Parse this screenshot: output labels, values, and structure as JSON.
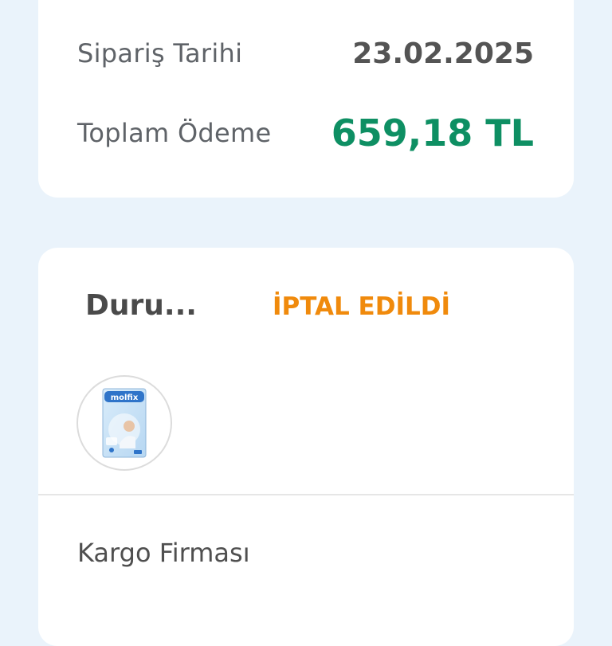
{
  "order": {
    "date_label": "Sipariş Tarihi",
    "date_value": "23.02.2025",
    "total_label": "Toplam Ödeme",
    "total_value": "659,18 TL"
  },
  "status": {
    "label": "Duru...",
    "value": "İPTAL EDİLDİ"
  },
  "product": {
    "brand_text": "molfix"
  },
  "shipping": {
    "carrier_label": "Kargo Firması"
  },
  "colors": {
    "background": "#eaf3fb",
    "total_green": "#0e8f63",
    "status_orange": "#f08a0c"
  }
}
